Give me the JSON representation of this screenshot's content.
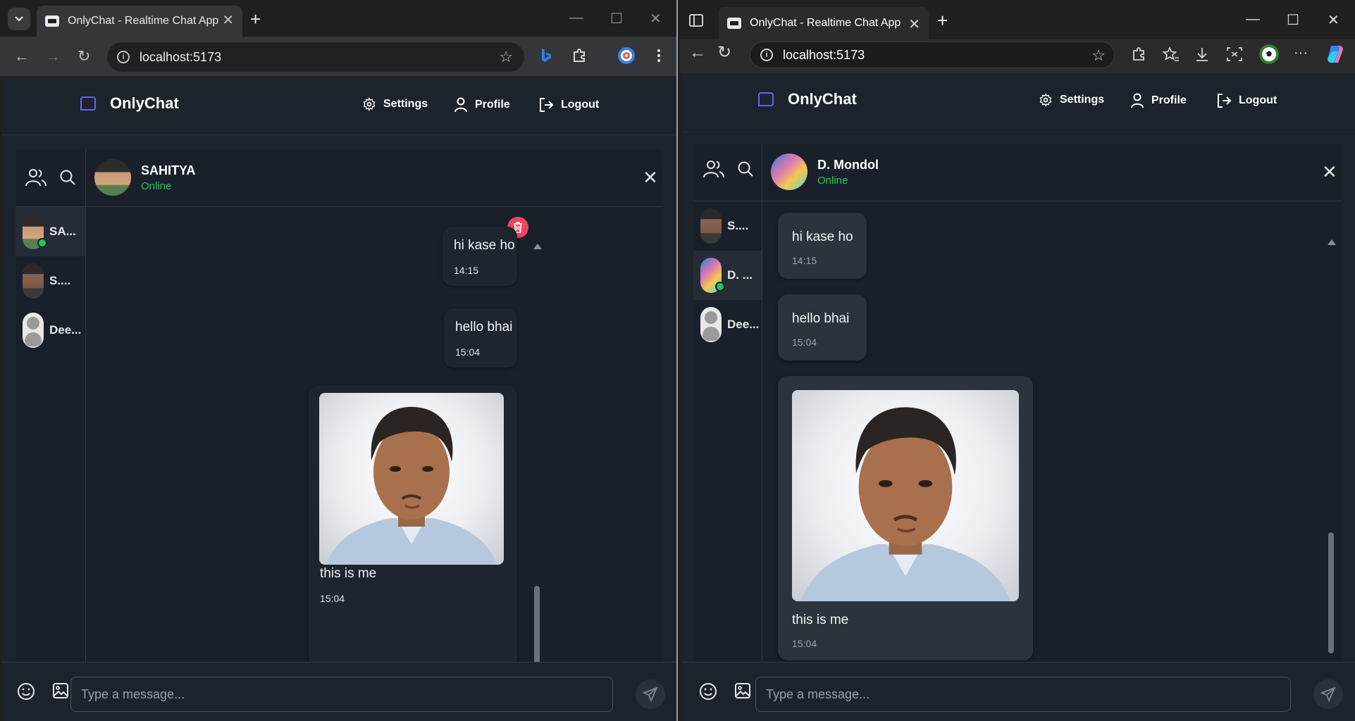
{
  "left_browser": {
    "tab_title": "OnlyChat - Realtime Chat App",
    "url": "localhost:5173",
    "icons": {
      "tab_search": "chevron-down-icon",
      "new_tab": "+",
      "minimize": "—",
      "maximize": "☐",
      "close": "✕",
      "back": "←",
      "forward": "→",
      "reload": "↻",
      "star": "☆"
    }
  },
  "right_browser": {
    "tab_title": "OnlyChat - Realtime Chat App",
    "url": "localhost:5173",
    "icons": {
      "new_tab": "+",
      "minimize": "—",
      "maximize": "☐",
      "close": "✕",
      "back": "←",
      "reload": "↻",
      "star": "☆",
      "more": "···"
    }
  },
  "app": {
    "brand": "OnlyChat",
    "nav": {
      "settings": "Settings",
      "profile": "Profile",
      "logout": "Logout"
    },
    "composer_placeholder": "Type a message...",
    "accent_color": "#6366f1",
    "online_color": "#22c55e",
    "delete_color": "#f04462"
  },
  "left_chat": {
    "contacts": [
      {
        "name": "SA...",
        "online": true,
        "active": true
      },
      {
        "name": "S....",
        "online": false,
        "active": false
      },
      {
        "name": "Dee...",
        "online": false,
        "active": false
      }
    ],
    "header": {
      "name": "SAHITYA",
      "status": "Online",
      "close": "✕"
    },
    "messages": [
      {
        "text": "hi kase ho",
        "time": "14:15"
      },
      {
        "text": "hello bhai",
        "time": "15:04"
      },
      {
        "text": "this is me",
        "time": "15:04",
        "has_image": true
      }
    ]
  },
  "right_chat": {
    "contacts": [
      {
        "name": "S....",
        "online": false,
        "active": false
      },
      {
        "name": "D. ...",
        "online": true,
        "active": true
      },
      {
        "name": "Dee...",
        "online": false,
        "active": false
      }
    ],
    "header": {
      "name": "D. Mondol",
      "status": "Online",
      "close": "✕"
    },
    "messages": [
      {
        "text": "hi kase ho",
        "time": "14:15"
      },
      {
        "text": "hello bhai",
        "time": "15:04"
      },
      {
        "text": "this is me",
        "time": "15:04",
        "has_image": true
      }
    ]
  }
}
